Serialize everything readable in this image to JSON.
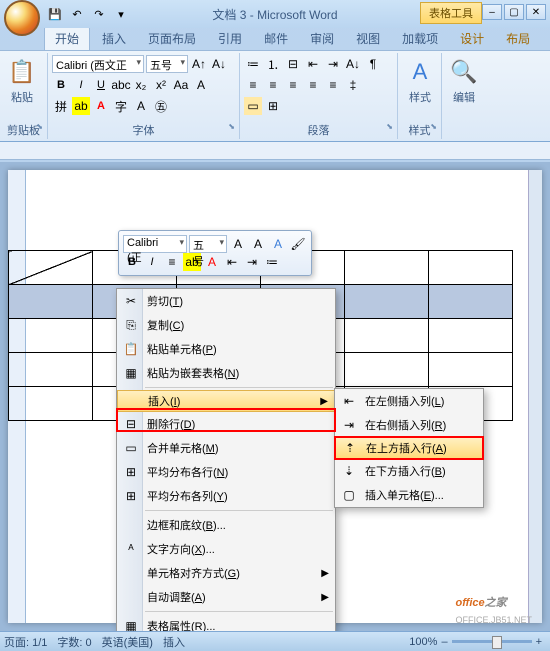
{
  "title": "文档 3 - Microsoft Word",
  "tool_context": "表格工具",
  "tabs": [
    "开始",
    "插入",
    "页面布局",
    "引用",
    "邮件",
    "审阅",
    "视图",
    "加载项"
  ],
  "ctx_tabs": [
    "设计",
    "布局"
  ],
  "ribbon": {
    "clipboard": {
      "label": "剪贴板",
      "paste": "粘贴"
    },
    "font": {
      "label": "字体",
      "name": "Calibri (西文正",
      "size": "五号"
    },
    "para": {
      "label": "段落"
    },
    "styles": {
      "label": "样式",
      "btn": "样式"
    },
    "edit": {
      "label": "",
      "btn": "编辑"
    }
  },
  "minitb": {
    "font": "Calibri (正",
    "size": "五号"
  },
  "context_menu": [
    {
      "icon": "✂",
      "label": "剪切",
      "key": "T"
    },
    {
      "icon": "⎘",
      "label": "复制",
      "key": "C"
    },
    {
      "icon": "📋",
      "label": "粘贴单元格",
      "key": "P"
    },
    {
      "icon": "▦",
      "label": "粘贴为嵌套表格",
      "key": "N"
    },
    {
      "sep": true
    },
    {
      "icon": "",
      "label": "插入",
      "key": "I",
      "arrow": true,
      "hl": true
    },
    {
      "icon": "⊟",
      "label": "删除行",
      "key": "D"
    },
    {
      "icon": "▭",
      "label": "合并单元格",
      "key": "M"
    },
    {
      "icon": "⊞",
      "label": "平均分布各行",
      "key": "N"
    },
    {
      "icon": "⊞",
      "label": "平均分布各列",
      "key": "Y"
    },
    {
      "sep": true
    },
    {
      "icon": "",
      "label": "边框和底纹",
      "key": "B",
      "dots": true
    },
    {
      "icon": "ᴬ",
      "label": "文字方向",
      "key": "X",
      "dots": true
    },
    {
      "icon": "",
      "label": "单元格对齐方式",
      "key": "G",
      "arrow": true
    },
    {
      "icon": "",
      "label": "自动调整",
      "key": "A",
      "arrow": true
    },
    {
      "sep": true
    },
    {
      "icon": "▦",
      "label": "表格属性",
      "key": "R",
      "dots": true
    }
  ],
  "submenu": [
    {
      "icon": "⇤",
      "label": "在左侧插入列",
      "key": "L"
    },
    {
      "icon": "⇥",
      "label": "在右侧插入列",
      "key": "R"
    },
    {
      "icon": "⇡",
      "label": "在上方插入行",
      "key": "A",
      "hl": true
    },
    {
      "icon": "⇣",
      "label": "在下方插入行",
      "key": "B"
    },
    {
      "icon": "▢",
      "label": "插入单元格",
      "key": "E",
      "dots": true
    }
  ],
  "status": {
    "page": "页面: 1/1",
    "words": "字数: 0",
    "lang": "英语(美国)",
    "mode": "插入",
    "zoom": "100%"
  },
  "watermark": {
    "a": "office",
    "b": "之家",
    "url": "OFFICE.JB51.NET"
  }
}
